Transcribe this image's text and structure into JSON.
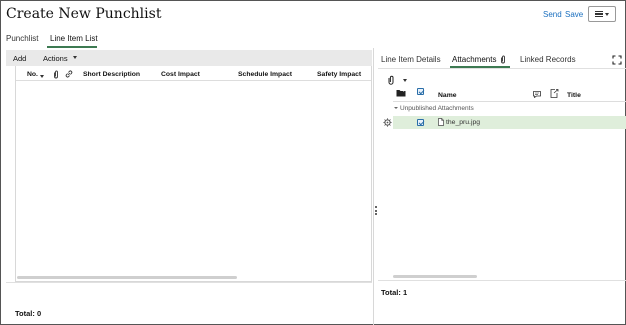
{
  "header": {
    "title": "Create New Punchlist",
    "send_label": "Send",
    "save_label": "Save"
  },
  "tabs": [
    {
      "label": "Punchlist",
      "active": false
    },
    {
      "label": "Line Item List",
      "active": true
    }
  ],
  "left_toolbar": {
    "add_label": "Add",
    "actions_label": "Actions"
  },
  "line_items_grid": {
    "columns": [
      "No.",
      "Short Description",
      "Cost Impact",
      "Schedule Impact",
      "Safety Impact"
    ],
    "rows": [],
    "total_label": "Total: 0"
  },
  "right_tabs": [
    {
      "label": "Line Item Details",
      "active": false
    },
    {
      "label": "Attachments",
      "active": true
    },
    {
      "label": "Linked Records",
      "active": false
    }
  ],
  "attachments_grid": {
    "columns": [
      "Name",
      "Title"
    ],
    "group_label": "Unpublished Attachments",
    "rows": [
      {
        "name": "the_pru.jpg",
        "checked": true,
        "selected": true
      }
    ],
    "total_label": "Total: 1"
  },
  "colors": {
    "link": "#1a6fbf",
    "active_tab_underline": "#3d7a52",
    "selected_row": "#dfeedb",
    "toolbar_bg": "#e9e9e9"
  }
}
